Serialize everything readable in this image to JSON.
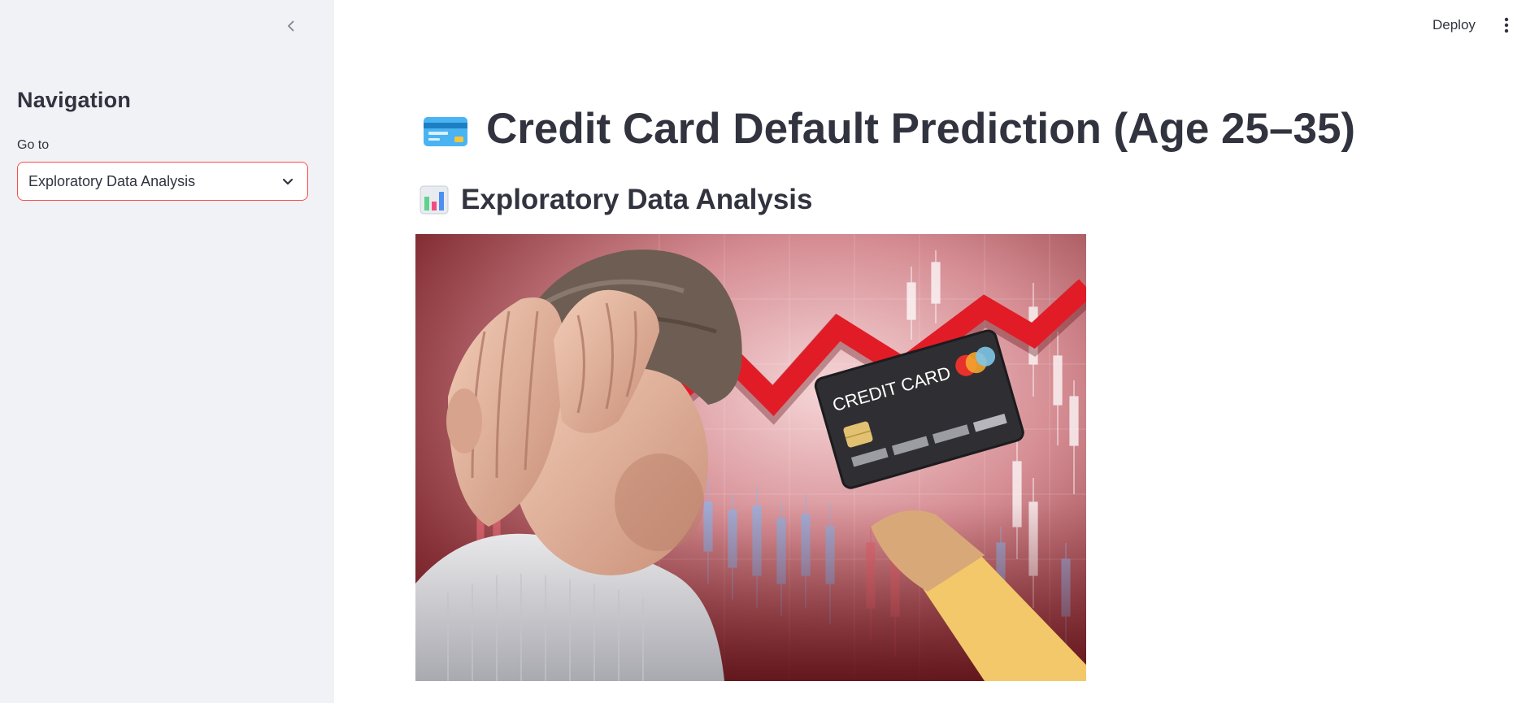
{
  "sidebar": {
    "title": "Navigation",
    "select_label": "Go to",
    "select_value": "Exploratory Data Analysis",
    "collapse_icon": "chevron-left-icon"
  },
  "header": {
    "deploy_label": "Deploy",
    "menu_icon": "vertical-dots-icon"
  },
  "main": {
    "title": "Credit Card Default Prediction (Age 25–35)",
    "title_icon": "credit-card-emoji-icon",
    "subtitle": "Exploratory Data Analysis",
    "subtitle_icon": "bar-chart-emoji-icon",
    "image": {
      "card_text": "CREDIT CARD"
    }
  },
  "colors": {
    "sidebar_bg": "#f0f2f6",
    "accent": "#ff4b4b",
    "text": "#31333f"
  }
}
